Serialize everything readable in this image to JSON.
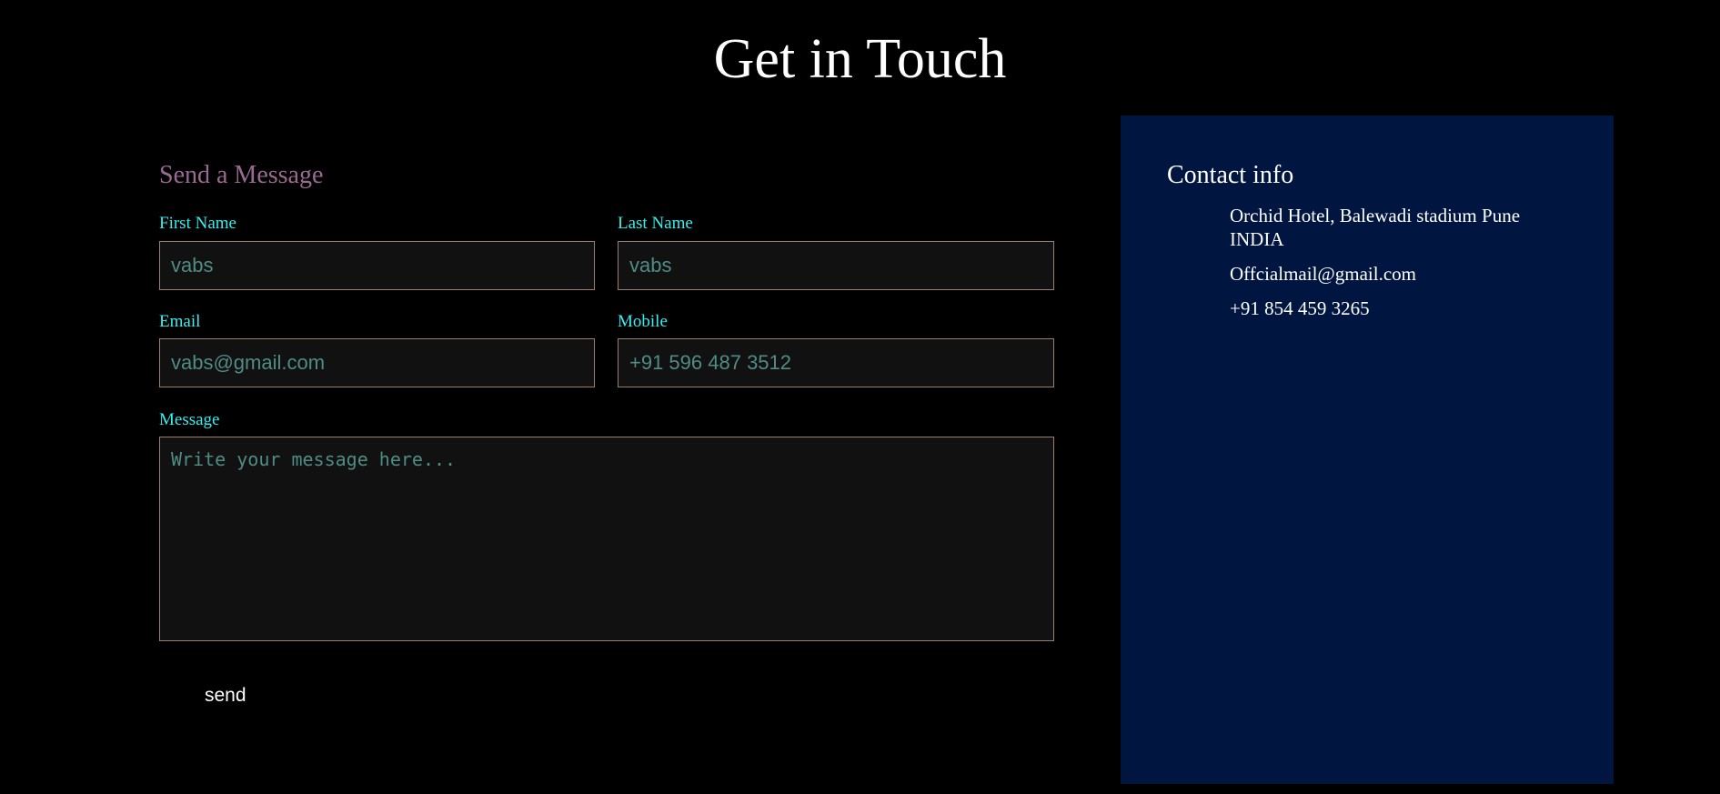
{
  "page": {
    "title": "Get in Touch"
  },
  "form": {
    "heading": "Send a Message",
    "first_name": {
      "label": "First Name",
      "placeholder": "vabs"
    },
    "last_name": {
      "label": "Last Name",
      "placeholder": "vabs"
    },
    "email": {
      "label": "Email",
      "placeholder": "vabs@gmail.com"
    },
    "mobile": {
      "label": "Mobile",
      "placeholder": "+91 596 487 3512"
    },
    "message": {
      "label": "Message",
      "placeholder": "Write your message here..."
    },
    "send_label": "send"
  },
  "contact": {
    "heading": "Contact info",
    "address": "Orchid Hotel, Balewadi stadium Pune INDIA",
    "email": "Offcialmail@gmail.com",
    "phone": "+91 854 459 3265"
  },
  "colors": {
    "background": "#000000",
    "panel": "#001641",
    "label": "#33f0f0",
    "heading_accent": "#9a6a92",
    "input_border": "#9b7f6c",
    "input_text": "#4f8c86"
  }
}
